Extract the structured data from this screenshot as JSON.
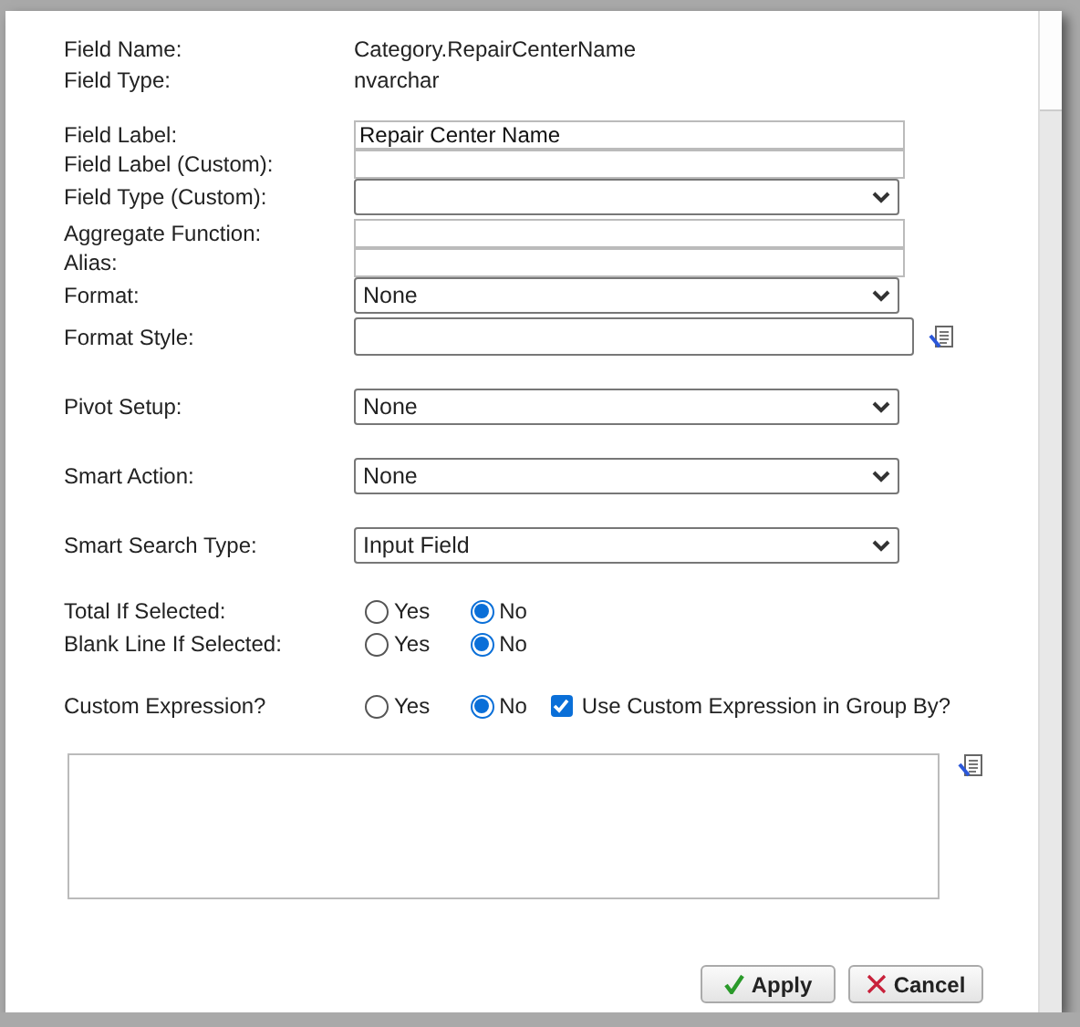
{
  "info": [
    {
      "label": "Field Name:",
      "value": "Category.RepairCenterName"
    },
    {
      "label": "Field Type:",
      "value": "nvarchar"
    }
  ],
  "groups": [
    [
      {
        "kind": "text",
        "label": "Field Label:",
        "value": "Repair Center Name"
      },
      {
        "kind": "text",
        "label": "Field Label (Custom):"
      },
      {
        "kind": "select",
        "label": "Field Type (Custom):"
      },
      {
        "kind": "text",
        "label": "Aggregate Function:"
      },
      {
        "kind": "text",
        "label": "Alias:"
      },
      {
        "kind": "select",
        "label": "Format:",
        "value": "None"
      },
      {
        "kind": "picker",
        "label": "Format Style:"
      }
    ],
    [
      {
        "kind": "select",
        "label": "Pivot Setup:",
        "value": "None"
      }
    ],
    [
      {
        "kind": "select",
        "label": "Smart Action:",
        "value": "None"
      }
    ],
    [
      {
        "kind": "select",
        "label": "Smart Search Type:",
        "value": "Input Field"
      }
    ],
    [
      {
        "kind": "radio",
        "label": "Total If Selected:",
        "options": [
          {
            "label": "Yes",
            "selected": false
          },
          {
            "label": "No",
            "selected": true
          }
        ]
      },
      {
        "kind": "radio",
        "label": "Blank Line If Selected:",
        "options": [
          {
            "label": "Yes",
            "selected": false
          },
          {
            "label": "No",
            "selected": true
          }
        ]
      }
    ],
    [
      {
        "kind": "radio",
        "label": "Custom Expression?",
        "options": [
          {
            "label": "Yes",
            "selected": false
          },
          {
            "label": "No",
            "selected": true
          }
        ],
        "checkbox": {
          "label": "Use Custom Expression in Group By?",
          "checked": true
        }
      }
    ]
  ],
  "expression": {
    "kind": "textarea"
  },
  "buttons": [
    {
      "kind": "apply",
      "label": "Apply"
    },
    {
      "kind": "cancel",
      "label": "Cancel"
    }
  ]
}
